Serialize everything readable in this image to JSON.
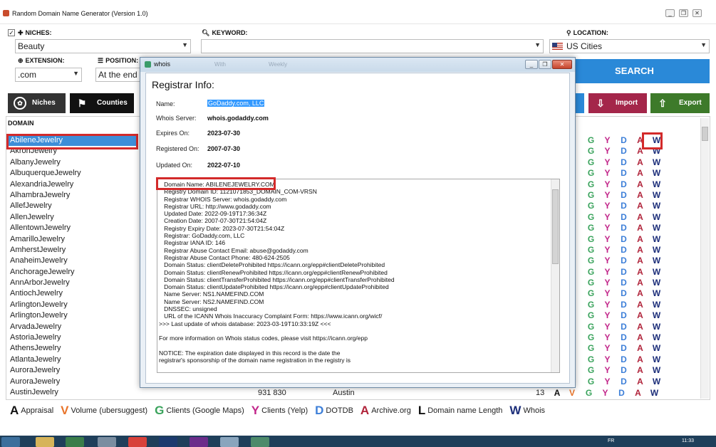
{
  "window": {
    "title": "Random Domain Name Generator (Version 1.0)",
    "controls": [
      "_",
      "❐",
      "✕"
    ]
  },
  "filters": {
    "niches_label": "NICHES:",
    "niches_value": "Beauty",
    "keyword_label": "KEYWORD:",
    "keyword_value": "",
    "location_label": "LOCATION:",
    "location_value": "US Cities",
    "extension_label": "EXTENSION:",
    "extension_value": ".com",
    "position_label": "POSITION:",
    "position_value": "At the end"
  },
  "buttons": {
    "search": "SEARCH",
    "niches": "Niches",
    "counties": "Counties",
    "import": "Import",
    "export": "Export"
  },
  "list": {
    "header": "DOMAIN",
    "domains": [
      "AbileneJewelry",
      "AkronJewelry",
      "AlbanyJewelry",
      "AlbuquerqueJewelry",
      "AlexandriaJewelry",
      "AlhambraJewelry",
      "AllefJewelry",
      "AllenJewelry",
      "AllentownJewelry",
      "AmarilloJewelry",
      "AmherstJewelry",
      "AnaheimJewelry",
      "AnchorageJewelry",
      "AnnArborJewelry",
      "AntiochJewelry",
      "ArlingtonJewelry",
      "ArlingtonJewelry",
      "ArvadaJewelry",
      "AstoriaJewelry",
      "AthensJewelry",
      "AtlantaJewelry",
      "AuroraJewelry",
      "AuroraJewelry",
      "AustinJewelry"
    ],
    "selected_index": 0,
    "last_row": {
      "volume": "931 830",
      "city": "Austin",
      "length": "13"
    },
    "letter_columns": [
      "G",
      "Y",
      "D",
      "A",
      "W"
    ],
    "last_row_letters": [
      "A",
      "V",
      "G",
      "Y",
      "D",
      "A",
      "W"
    ]
  },
  "legend": [
    {
      "letter": "A",
      "text": "Appraisal",
      "color": "#111111"
    },
    {
      "letter": "V",
      "text": "Volume (ubersuggest)",
      "color": "#e8742a"
    },
    {
      "letter": "G",
      "text": "Clients (Google Maps)",
      "color": "#3aa35c"
    },
    {
      "letter": "Y",
      "text": "Clients (Yelp)",
      "color": "#c2268a"
    },
    {
      "letter": "D",
      "text": "DOTDB",
      "color": "#3d7fd8"
    },
    {
      "letter": "A",
      "text": "Archive.org",
      "color": "#b0233a"
    },
    {
      "letter": "L",
      "text": "Domain name Length",
      "color": "#111111"
    },
    {
      "letter": "W",
      "text": "Whois",
      "color": "#1d2f7a"
    }
  ],
  "colors": {
    "G": "#3aa35c",
    "Y": "#c2268a",
    "D": "#3d7fd8",
    "A": "#b0233a",
    "W": "#1d2f7a",
    "V": "#e8742a",
    "A0": "#111111"
  },
  "whois": {
    "title": "whois",
    "ghost_tabs": [
      "With",
      "Weekly"
    ],
    "heading": "Registrar Info:",
    "name_label": "Name:",
    "name_value": "GoDaddy.com, LLC",
    "server_label": "Whois Server:",
    "server_value": "whois.godaddy.com",
    "expires_label": "Expires On:",
    "expires_value": "2023-07-30",
    "registered_label": "Registered On:",
    "registered_value": "2007-07-30",
    "updated_label": "Updated On:",
    "updated_value": "2022-07-10",
    "raw_lines": [
      "   Domain Name: ABILENEJEWELRY.COM",
      "   Registry Domain ID: 1121071853_DOMAIN_COM-VRSN",
      "   Registrar WHOIS Server: whois.godaddy.com",
      "   Registrar URL: http://www.godaddy.com",
      "   Updated Date: 2022-09-19T17:36:34Z",
      "   Creation Date: 2007-07-30T21:54:04Z",
      "   Registry Expiry Date: 2023-07-30T21:54:04Z",
      "   Registrar: GoDaddy.com, LLC",
      "   Registrar IANA ID: 146",
      "   Registrar Abuse Contact Email: abuse@godaddy.com",
      "   Registrar Abuse Contact Phone: 480-624-2505",
      "   Domain Status: clientDeleteProhibited https://icann.org/epp#clientDeleteProhibited",
      "   Domain Status: clientRenewProhibited https://icann.org/epp#clientRenewProhibited",
      "   Domain Status: clientTransferProhibited https://icann.org/epp#clientTransferProhibited",
      "   Domain Status: clientUpdateProhibited https://icann.org/epp#clientUpdateProhibited",
      "   Name Server: NS1.NAMEFIND.COM",
      "   Name Server: NS2.NAMEFIND.COM",
      "   DNSSEC: unsigned",
      "   URL of the ICANN Whois Inaccuracy Complaint Form: https://www.icann.org/wicf/",
      ">>> Last update of whois database: 2023-03-19T10:33:19Z <<<",
      "",
      "For more information on Whois status codes, please visit https://icann.org/epp",
      "",
      "NOTICE: The expiration date displayed in this record is the date the",
      "registrar's sponsorship of the domain name registration in the registry is"
    ]
  },
  "taskbar": {
    "lang": "FR",
    "time": "11:33"
  }
}
